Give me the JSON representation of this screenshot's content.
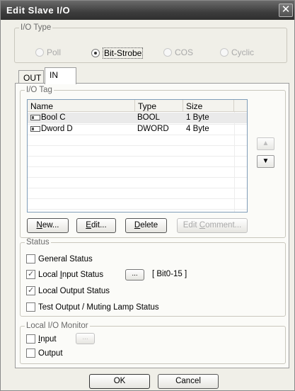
{
  "window": {
    "title": "Edit Slave I/O",
    "close_glyph": "✕"
  },
  "io_type": {
    "legend": "I/O Type",
    "options": [
      {
        "label": "Poll",
        "selected": false
      },
      {
        "label": "Bit-Strobe",
        "selected": true
      },
      {
        "label": "COS",
        "selected": false
      },
      {
        "label": "Cyclic",
        "selected": false
      }
    ]
  },
  "tabs": [
    {
      "label": "OUT",
      "active": false
    },
    {
      "label": "IN",
      "active": true
    }
  ],
  "io_tag": {
    "legend": "I/O Tag",
    "columns": [
      "Name",
      "Type",
      "Size"
    ],
    "rows": [
      {
        "name": "Bool C",
        "type": "BOOL",
        "size": "1 Byte",
        "icon": "tag-icon"
      },
      {
        "name": "Dword D",
        "type": "DWORD",
        "size": "4 Byte",
        "icon": "tag-icon"
      }
    ],
    "move_up_glyph": "▲",
    "move_down_glyph": "▼",
    "buttons": {
      "new_label": "ew...",
      "new_mnemonic": "N",
      "edit_label": "dit...",
      "edit_mnemonic": "E",
      "delete_label": "elete",
      "delete_mnemonic": "D",
      "edit_comment_prefix": "Edit ",
      "edit_comment_mnemonic": "C",
      "edit_comment_suffix": "omment..."
    }
  },
  "status": {
    "legend": "Status",
    "general": {
      "label": "General Status",
      "checked": false
    },
    "local_input": {
      "label_prefix": "Local ",
      "mnemonic": "I",
      "label_suffix": "nput Status",
      "checked": true,
      "browse": "...",
      "range": "[ Bit0-15 ]"
    },
    "local_output": {
      "label": "Local Output Status",
      "checked": true
    },
    "test_output": {
      "label": "Test Output / Muting Lamp Status",
      "checked": false
    }
  },
  "monitor": {
    "legend": "Local I/O Monitor",
    "input": {
      "label_mnemonic": "I",
      "label_rest": "nput",
      "checked": false,
      "browse": "..."
    },
    "output": {
      "label": "Output",
      "checked": false
    }
  },
  "footer": {
    "ok": "OK",
    "cancel": "Cancel"
  }
}
